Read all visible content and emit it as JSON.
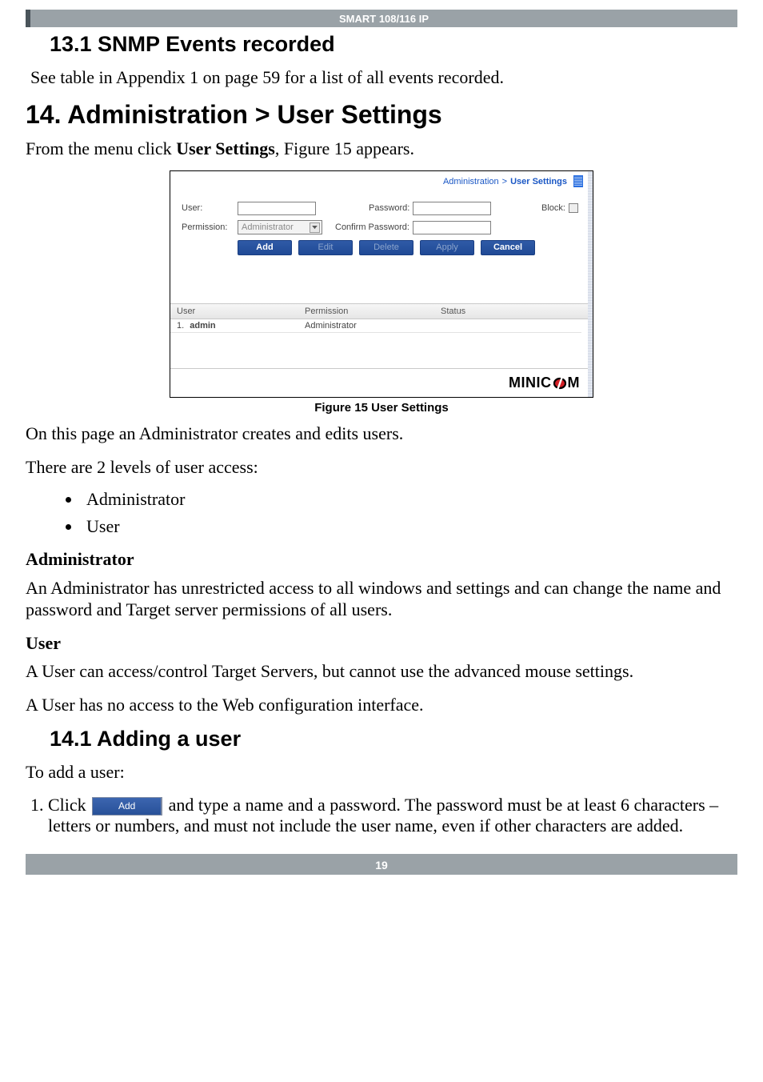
{
  "top_banner": "SMART 108/116 IP",
  "h2_13_1": "13.1 SNMP Events recorded",
  "p_see_table": "See table in Appendix 1 on page 59 for a list of all events recorded.",
  "h1_14": "14. Administration > User Settings",
  "p_from_menu_a": "From the menu click ",
  "p_from_menu_b": "User Settings",
  "p_from_menu_c": ", Figure 15 appears.",
  "figure_caption": "Figure 15 User Settings",
  "shot": {
    "breadcrumb1": "Administration",
    "breadcrumb_gt": ">",
    "breadcrumb2": "User Settings",
    "user_label": "User:",
    "password_label": "Password:",
    "block_label": "Block:",
    "permission_label": "Permission:",
    "permission_value": "Administrator",
    "confirm_label": "Confirm Password:",
    "btn_add": "Add",
    "btn_edit": "Edit",
    "btn_delete": "Delete",
    "btn_apply": "Apply",
    "btn_cancel": "Cancel",
    "col_user": "User",
    "col_permission": "Permission",
    "col_status": "Status",
    "row1_idx": "1.",
    "row1_user": "admin",
    "row1_perm": "Administrator",
    "row1_status": "",
    "logo_a": "MINIC",
    "logo_b": "M"
  },
  "p_on_this_page": "On this page an Administrator creates and edits users.",
  "p_two_levels": "There are 2 levels of user access:",
  "li_admin": "Administrator",
  "li_user": "User",
  "h_admin": "Administrator",
  "p_admin_desc": "An Administrator has unrestricted access to all windows and settings and can change the name and password and Target server permissions of all users.",
  "h_user": "User",
  "p_user_desc1": "A User can access/control Target Servers, but cannot use the advanced mouse settings.",
  "p_user_desc2": "A User has no access to the Web configuration interface.",
  "h2_14_1": "14.1 Adding a user",
  "p_to_add": "To add a user:",
  "step1_a": "Click ",
  "step1_btn": "Add",
  "step1_b": " and type a name and a password. The password must be at least 6 characters – letters or numbers, and must not include the user name, even if other characters are added.",
  "page_num": "19"
}
